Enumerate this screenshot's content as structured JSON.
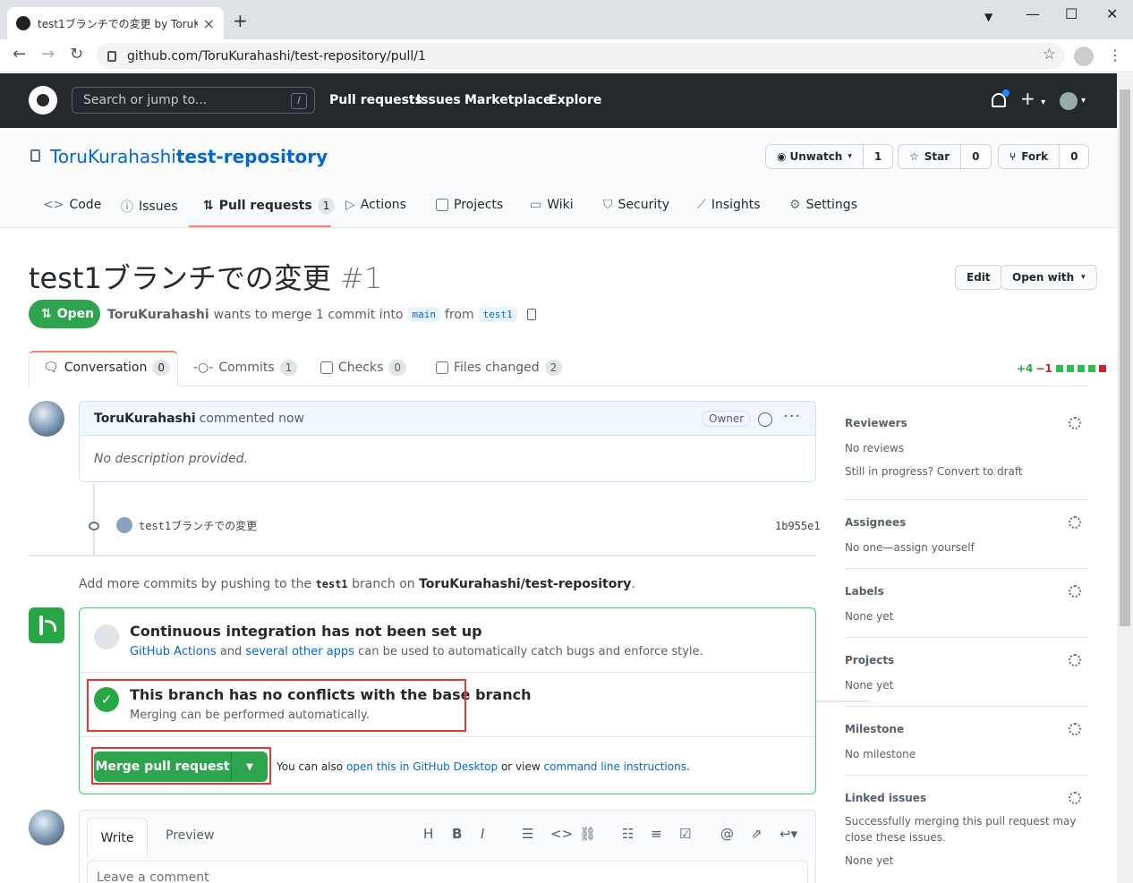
{
  "browser": {
    "tab_title": "test1ブランチでの変更 by ToruKurah",
    "url": "github.com/ToruKurahashi/test-repository/pull/1"
  },
  "gh": {
    "search_placeholder": "Search or jump to...",
    "search_key": "/",
    "nav": [
      "Pull requests",
      "Issues",
      "Marketplace",
      "Explore"
    ]
  },
  "repo": {
    "owner": "ToruKurahashi",
    "sep": "/",
    "name": "test-repository",
    "watch_label": "Unwatch",
    "watch_count": "1",
    "star_label": "Star",
    "star_count": "0",
    "fork_label": "Fork",
    "fork_count": "0",
    "tabs": [
      {
        "label": "Code",
        "icon": "code-icon"
      },
      {
        "label": "Issues",
        "icon": "issue-icon"
      },
      {
        "label": "Pull requests",
        "icon": "pull-request-icon",
        "count": "1"
      },
      {
        "label": "Actions",
        "icon": "play-icon"
      },
      {
        "label": "Projects",
        "icon": "project-icon"
      },
      {
        "label": "Wiki",
        "icon": "book-icon"
      },
      {
        "label": "Security",
        "icon": "shield-icon"
      },
      {
        "label": "Insights",
        "icon": "graph-icon"
      },
      {
        "label": "Settings",
        "icon": "gear-icon"
      }
    ]
  },
  "pr": {
    "title": "test1ブランチでの変更",
    "number": "#1",
    "edit_label": "Edit",
    "open_with_label": "Open with",
    "state": "Open",
    "author": "ToruKurahashi",
    "meta_text": "wants to merge 1 commit into",
    "base_branch": "main",
    "from_text": "from",
    "head_branch": "test1",
    "tabs": [
      {
        "label": "Conversation",
        "count": "0"
      },
      {
        "label": "Commits",
        "count": "1"
      },
      {
        "label": "Checks",
        "count": "0"
      },
      {
        "label": "Files changed",
        "count": "2"
      }
    ],
    "additions": "+4",
    "deletions": "−1"
  },
  "comment": {
    "author": "ToruKurahashi",
    "time": "commented now",
    "role": "Owner",
    "body": "No description provided."
  },
  "commit": {
    "message": "test1ブランチでの変更",
    "sha": "1b955e1"
  },
  "addmore": {
    "prefix": "Add more commits by pushing to the",
    "branch": "test1",
    "mid": "branch on",
    "repo": "ToruKurahashi/test-repository",
    "suffix": "."
  },
  "merge": {
    "ci_title": "Continuous integration has not been set up",
    "ci_link1": "GitHub Actions",
    "ci_and": "and",
    "ci_link2": "several other apps",
    "ci_rest": "can be used to automatically catch bugs and enforce style.",
    "ok_title": "This branch has no conflicts with the base branch",
    "ok_sub": "Merging can be performed automatically.",
    "button": "Merge pull request",
    "also_prefix": "You can also",
    "also_link1": "open this in GitHub Desktop",
    "also_mid": "or view",
    "also_link2": "command line instructions",
    "also_suffix": "."
  },
  "composer": {
    "write": "Write",
    "preview": "Preview",
    "placeholder": "Leave a comment"
  },
  "sidebar": [
    {
      "heading": "Reviewers",
      "lines": [
        "No reviews",
        "Still in progress? Convert to draft"
      ]
    },
    {
      "heading": "Assignees",
      "lines": [
        "No one—assign yourself"
      ]
    },
    {
      "heading": "Labels",
      "lines": [
        "None yet"
      ]
    },
    {
      "heading": "Projects",
      "lines": [
        "None yet"
      ]
    },
    {
      "heading": "Milestone",
      "lines": [
        "No milestone"
      ]
    },
    {
      "heading": "Linked issues",
      "lines": [
        "Successfully merging this pull request may close these issues.",
        "None yet"
      ]
    }
  ]
}
